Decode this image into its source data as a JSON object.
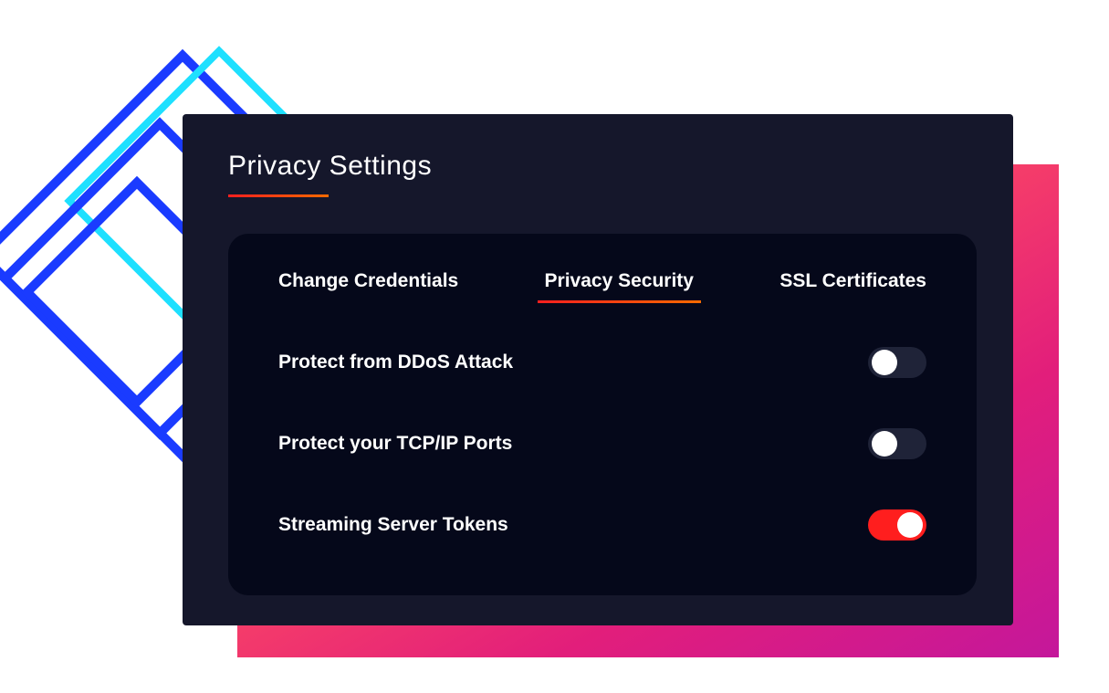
{
  "panel": {
    "title": "Privacy Settings"
  },
  "tabs": {
    "change_credentials": "Change Credentials",
    "privacy_security": "Privacy Security",
    "ssl_certificates": "SSL Certificates",
    "active": "privacy_security"
  },
  "settings": {
    "ddos": {
      "label": "Protect from DDoS Attack",
      "enabled": false
    },
    "tcpip": {
      "label": "Protect your TCP/IP Ports",
      "enabled": false
    },
    "streaming": {
      "label": "Streaming Server Tokens",
      "enabled": true
    }
  },
  "colors": {
    "panel_bg": "#15172b",
    "inner_bg": "#05081a",
    "accent_gradient_start": "#ff1f1f",
    "accent_gradient_end": "#ff6a00",
    "toggle_on": "#ff1e1e",
    "toggle_off": "#1f2338"
  }
}
